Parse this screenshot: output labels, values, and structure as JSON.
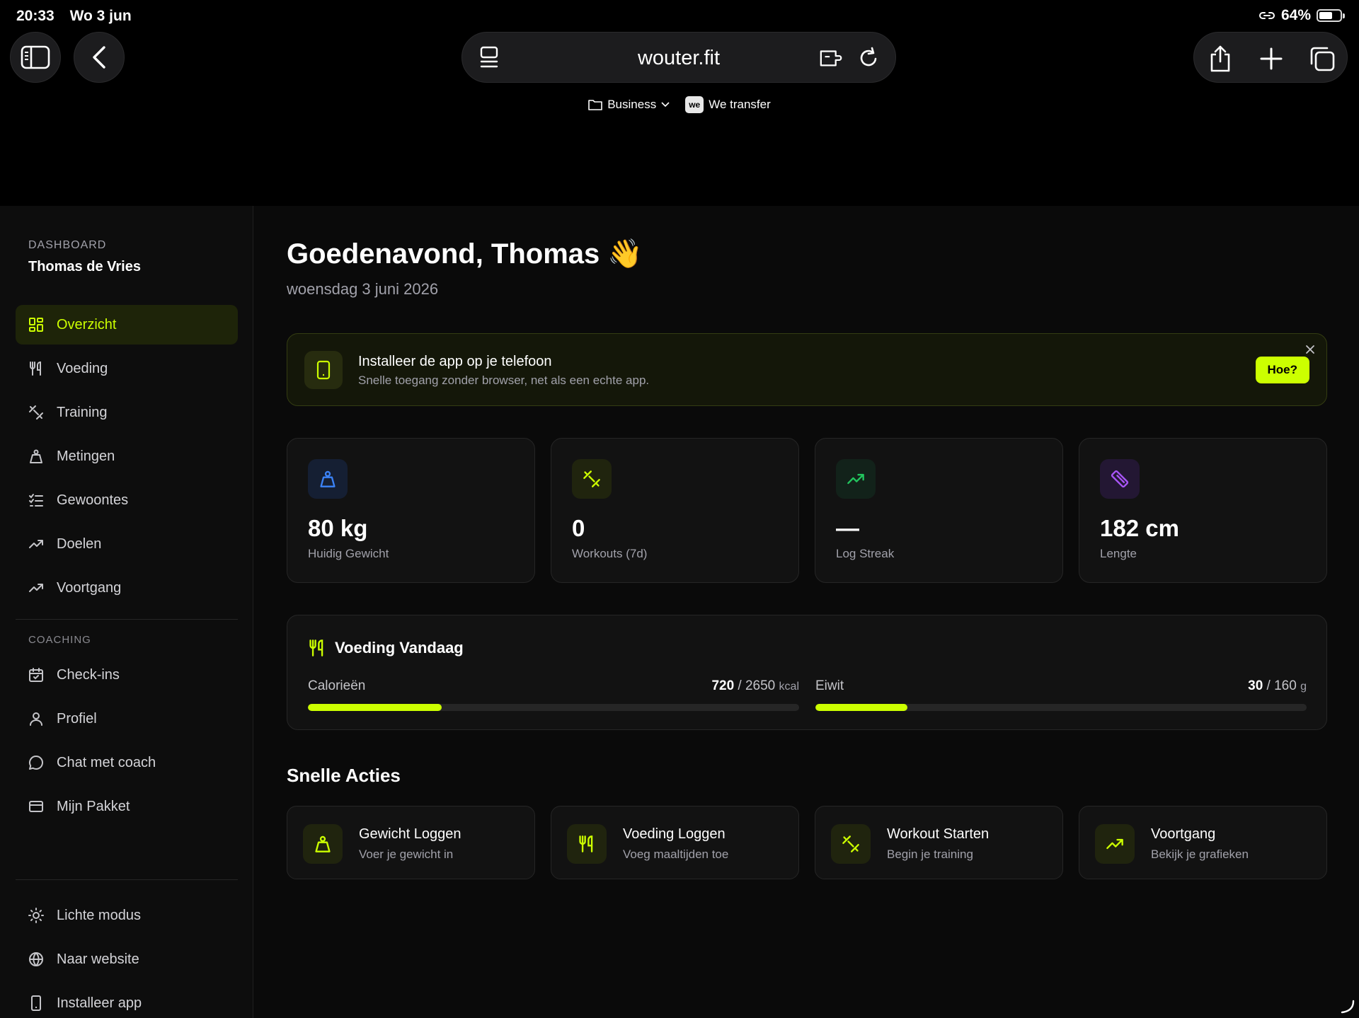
{
  "status_bar": {
    "time": "20:33",
    "date": "Wo 3 jun",
    "battery": "64%",
    "battery_level": 0.64
  },
  "browser": {
    "url": "wouter.fit",
    "bookmarks": [
      {
        "label": "Business",
        "icon": "folder-icon",
        "has_dropdown": true
      },
      {
        "label": "We transfer",
        "icon": "wetransfer-icon",
        "logo_text": "we"
      }
    ]
  },
  "sidebar": {
    "section_label": "DASHBOARD",
    "user_name": "Thomas de Vries",
    "main_items": [
      {
        "label": "Overzicht",
        "icon": "grid-icon",
        "active": true
      },
      {
        "label": "Voeding",
        "icon": "utensils-icon"
      },
      {
        "label": "Training",
        "icon": "dumbbell-icon"
      },
      {
        "label": "Metingen",
        "icon": "weight-icon"
      },
      {
        "label": "Gewoontes",
        "icon": "checklist-icon"
      },
      {
        "label": "Doelen",
        "icon": "trend-icon"
      },
      {
        "label": "Voortgang",
        "icon": "trend-icon"
      }
    ],
    "coaching_label": "COACHING",
    "coaching_items": [
      {
        "label": "Check-ins",
        "icon": "calendar-icon"
      },
      {
        "label": "Profiel",
        "icon": "user-icon"
      },
      {
        "label": "Chat met coach",
        "icon": "chat-icon"
      },
      {
        "label": "Mijn Pakket",
        "icon": "card-icon"
      }
    ],
    "footer_items": [
      {
        "label": "Lichte modus",
        "icon": "sun-icon"
      },
      {
        "label": "Naar website",
        "icon": "globe-icon"
      },
      {
        "label": "Installeer app",
        "icon": "phone-icon"
      }
    ]
  },
  "header": {
    "greeting": "Goedenavond, Thomas 👋",
    "date": "woensdag 3 juni 2026"
  },
  "install_banner": {
    "title": "Installeer de app op je telefoon",
    "subtitle": "Snelle toegang zonder browser, net als een echte app.",
    "button": "Hoe?"
  },
  "stats": [
    {
      "value": "80 kg",
      "label": "Huidig Gewicht",
      "icon": "weight-icon",
      "color": "#3b82f6"
    },
    {
      "value": "0",
      "label": "Workouts (7d)",
      "icon": "dumbbell-icon",
      "color": "#ccff00"
    },
    {
      "value": "—",
      "label": "Log Streak",
      "icon": "trend-icon",
      "color": "#22c55e"
    },
    {
      "value": "182 cm",
      "label": "Lengte",
      "icon": "ruler-icon",
      "color": "#a855f7"
    }
  ],
  "nutrition": {
    "title": "Voeding Vandaag",
    "macros": [
      {
        "label": "Calorieën",
        "current": "720",
        "target": "2650",
        "unit": "kcal",
        "fraction": 0.2717
      },
      {
        "label": "Eiwit",
        "current": "30",
        "target": "160",
        "unit": "g",
        "fraction": 0.1875
      }
    ]
  },
  "quick_actions": {
    "title": "Snelle Acties",
    "items": [
      {
        "title": "Gewicht Loggen",
        "subtitle": "Voer je gewicht in",
        "icon": "weight-icon"
      },
      {
        "title": "Voeding Loggen",
        "subtitle": "Voeg maaltijden toe",
        "icon": "utensils-icon"
      },
      {
        "title": "Workout Starten",
        "subtitle": "Begin je training",
        "icon": "dumbbell-icon"
      },
      {
        "title": "Voortgang",
        "subtitle": "Bekijk je grafieken",
        "icon": "trend-icon"
      }
    ]
  },
  "colors": {
    "accent": "#ccff00",
    "background": "#0a0a0a",
    "card": "#121212"
  }
}
